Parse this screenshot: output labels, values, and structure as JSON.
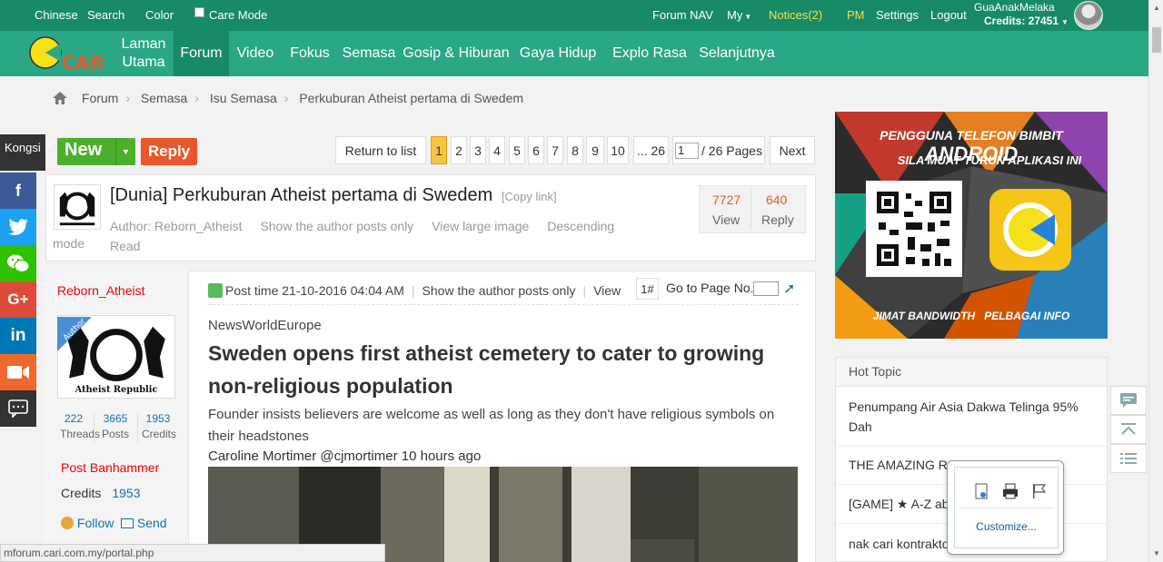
{
  "topbar": {
    "chinese": "Chinese",
    "search": "Search",
    "color": "Color",
    "care_mode": "Care Mode",
    "forum_nav": "Forum NAV",
    "my": "My",
    "notices": "Notices(2)",
    "pm": "PM",
    "settings": "Settings",
    "logout": "Logout",
    "username": "GuaAnakMelaka",
    "credits": "Credits: 27451"
  },
  "logo_text": "CARI",
  "nav": {
    "laman_line1": "Laman",
    "laman_line2": "Utama",
    "items": [
      "Forum",
      "Video",
      "Fokus",
      "Semasa",
      "Gosip & Hiburan",
      "Gaya Hidup",
      "Explo Rasa",
      "Selanjutnya"
    ]
  },
  "breadcrumb": [
    "Forum",
    "Semasa",
    "Isu Semasa",
    "Perkuburan Atheist pertama di Swedem"
  ],
  "share": {
    "label": "Kongsi",
    "buttons": [
      {
        "name": "facebook",
        "glyph": "f",
        "color": "#3b5998"
      },
      {
        "name": "twitter",
        "glyph": "t",
        "color": "#1da1f2"
      },
      {
        "name": "wechat",
        "glyph": "w",
        "color": "#2dc100"
      },
      {
        "name": "googleplus",
        "glyph": "G+",
        "color": "#dd4b39"
      },
      {
        "name": "linkedin",
        "glyph": "in",
        "color": "#0077b5"
      },
      {
        "name": "video",
        "glyph": "▶",
        "color": "#f0682d"
      },
      {
        "name": "message",
        "glyph": "…",
        "color": "#333333"
      }
    ]
  },
  "actions": {
    "new": "New",
    "reply": "Reply"
  },
  "pagination": {
    "return": "Return to list",
    "pages": [
      "1",
      "2",
      "3",
      "4",
      "5",
      "6",
      "7",
      "8",
      "9",
      "10"
    ],
    "last": "... 26",
    "input_value": "1",
    "total": "/ 26 Pages",
    "next": "Next"
  },
  "thread": {
    "title": "[Dunia] Perkuburan Atheist pertama di Swedem",
    "copy_link": "[Copy link]",
    "author": "Author: Reborn_Atheist",
    "show_author": "Show the author posts only",
    "view_large": "View large image",
    "descending": "Descending",
    "read": "Read",
    "mode": "mode",
    "views": "7727",
    "views_label": "View",
    "replies": "640",
    "replies_label": "Reply"
  },
  "post": {
    "author": "Reborn_Atheist",
    "author_badge": "Author",
    "avatar_text": "Atheist Republic",
    "stats": [
      {
        "n": "222",
        "l": "Threads"
      },
      {
        "n": "3665",
        "l": "Posts"
      },
      {
        "n": "1953",
        "l": "Credits"
      }
    ],
    "banhammer": "Post Banhammer",
    "credits_label": "Credits",
    "credits_value": "1953",
    "follow": "Follow",
    "send": "Send",
    "time": "Post time 21-10-2016 04:04 AM",
    "show_author": "Show the author posts only",
    "view": "View",
    "floor": "1#",
    "goto": "Go to Page No.",
    "source": "NewsWorldEurope",
    "headline": "Sweden opens first atheist cemetery to cater to growing non-religious population",
    "subheadline": "Founder insists believers are welcome as well as long as they don't have religious symbols on their headstones",
    "byline": "Caroline Mortimer @cjmortimer 10 hours  ago"
  },
  "ad": {
    "line1_a": "PENGGUNA TELEFON BIMBIT",
    "line1_b": "ANDROID",
    "line2": "SILA MUAT TURUN APLIKASI INI",
    "footer_a": "JIMAT BANDWIDTH",
    "footer_b": "PELBAGAI INFO"
  },
  "hot": {
    "title": "Hot Topic",
    "items": [
      "Penumpang Air Asia Dakwa Telinga 95% Dah",
      "THE AMAZING RA",
      "[GAME] ★ A-Z abo",
      "nak cari kontrakto                    tap"
    ]
  },
  "popup": {
    "customize": "Customize..."
  },
  "statusbar": "mforum.cari.com.my/portal.php",
  "colors": {
    "topbar": "#178a67",
    "navbar": "#2aa785",
    "accent_orange": "#e8582b",
    "new_green": "#4caf2a"
  }
}
